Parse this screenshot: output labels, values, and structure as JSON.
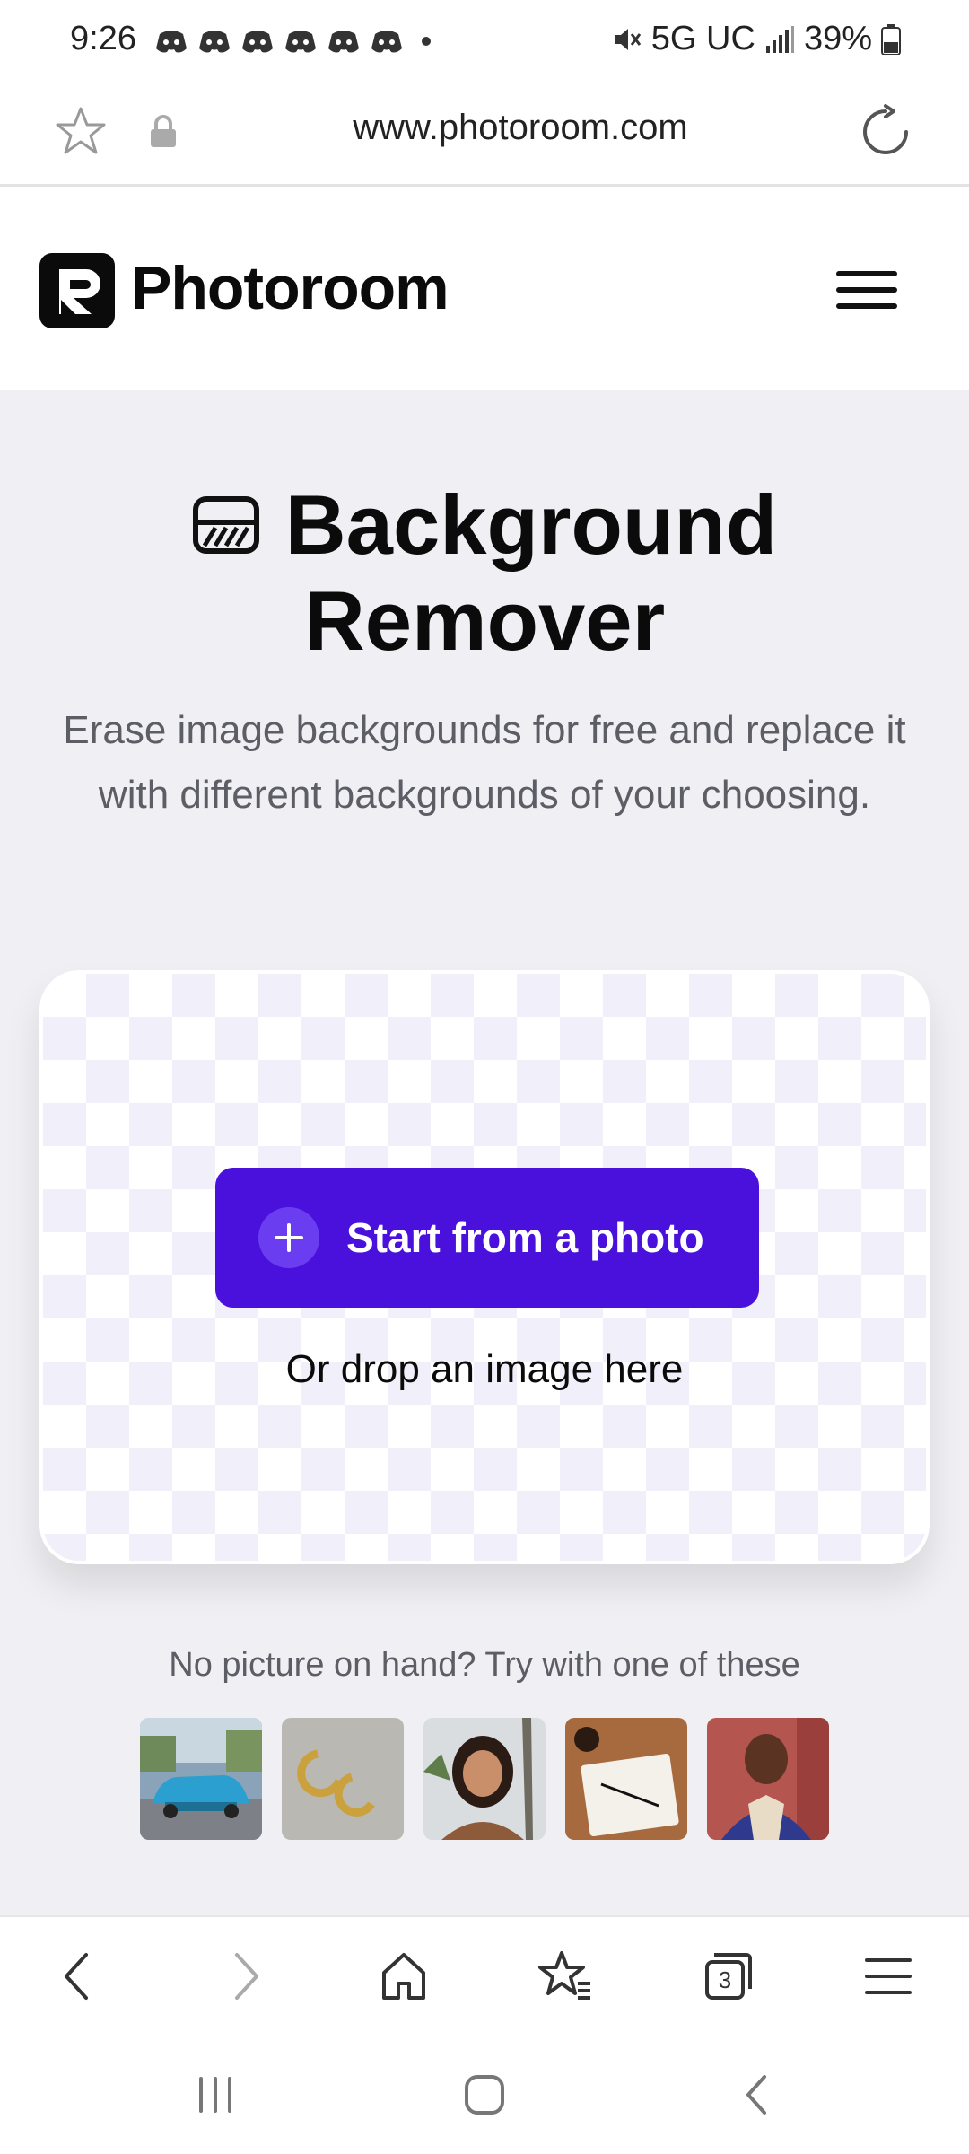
{
  "status": {
    "time": "9:26",
    "network": "5G UC",
    "battery": "39%",
    "notification_icons": [
      "discord-icon",
      "discord-icon",
      "discord-icon",
      "discord-icon",
      "discord-icon",
      "discord-icon"
    ]
  },
  "browser": {
    "url": "www.photoroom.com",
    "bottom_tabs_count": "3"
  },
  "site": {
    "brand": "Photoroom",
    "accent": "#4a10dc"
  },
  "hero": {
    "title_line1": "Background",
    "title_line2": "Remover",
    "subtitle": "Erase image backgrounds for free and replace it with different backgrounds of your choosing.",
    "cta_label": "Start from a photo",
    "drop_label": "Or drop an image here",
    "try_label": "No picture on hand? Try with one of these"
  }
}
